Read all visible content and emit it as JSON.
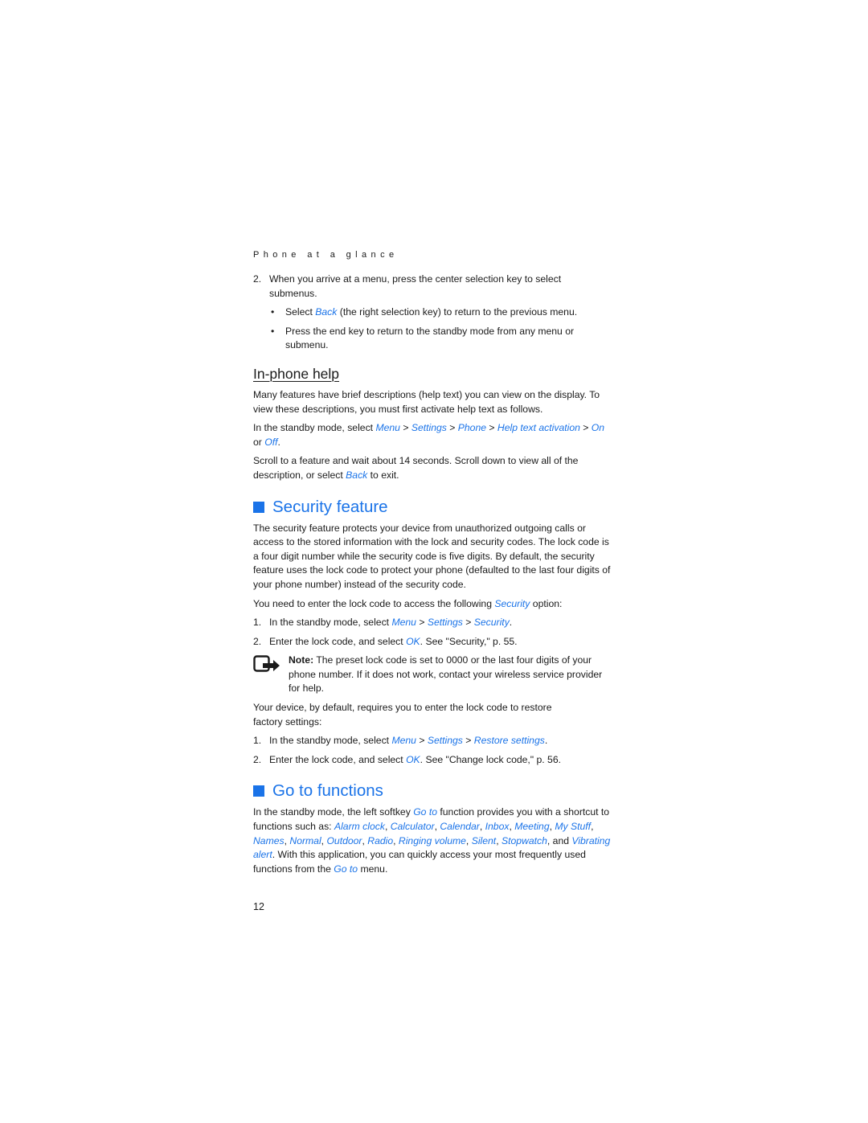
{
  "running_header": "Phone at a glance",
  "intro_list": {
    "item2": {
      "num": "2.",
      "text": "When you arrive at a menu, press the center selection key to select submenus."
    },
    "bullets": [
      {
        "dot": "•",
        "before": "Select ",
        "link": "Back",
        "after": " (the right selection key) to return to the previous menu."
      },
      {
        "dot": "•",
        "text": "Press the end key to return to the standby mode from any menu or submenu."
      }
    ]
  },
  "in_phone_help": {
    "heading": "In-phone help",
    "para1": "Many features have brief descriptions (help text) you can view on the display. To view these descriptions, you must first activate help text as follows.",
    "path": {
      "prefix": "In the standby mode, select ",
      "menu": "Menu",
      "sep": " > ",
      "settings": "Settings",
      "phone": "Phone",
      "help_text_activation": "Help text activation",
      "on": "On",
      "or": " or ",
      "off": "Off",
      "end": "."
    },
    "para3": {
      "before": "Scroll to a feature and wait about 14 seconds. Scroll down to view all of the description, or select ",
      "link": "Back",
      "after": " to exit."
    }
  },
  "security_feature": {
    "heading": "Security feature",
    "para1": "The security feature protects your device from unauthorized outgoing calls or access to the stored information with the lock and security codes. The lock code is a four digit number while the security code is five digits. By default, the security feature uses the lock code to protect your phone (defaulted to the last four digits of your phone number) instead of the security code.",
    "para2": {
      "before": "You need to enter the lock code to access the following ",
      "link": "Security",
      "after": " option:"
    },
    "steps1": [
      {
        "num": "1.",
        "prefix": "In the standby mode, select ",
        "menu": "Menu",
        "sep": " > ",
        "settings": "Settings",
        "target": "Security",
        "end": "."
      },
      {
        "num": "2.",
        "prefix": "Enter the lock code, and select ",
        "ok": "OK",
        "suffix": ". See \"Security,\" p. 55."
      }
    ],
    "note": {
      "icon": "note-hand-icon",
      "label": "Note:",
      "text": " The preset lock code is set to 0000 or the last four digits of your phone number. If it does not work, contact your wireless service provider for help."
    },
    "para3": "Your device, by default, requires you to enter the lock code to restore factory settings:",
    "steps2": [
      {
        "num": "1.",
        "prefix": "In the standby mode, select ",
        "menu": "Menu",
        "sep": " > ",
        "settings": "Settings",
        "target": "Restore settings",
        "end": "."
      },
      {
        "num": "2.",
        "prefix": "Enter the lock code, and select ",
        "ok": "OK",
        "suffix": ". See \"Change lock code,\" p. 56."
      }
    ]
  },
  "go_to_functions": {
    "heading": "Go to functions",
    "intro_before": "In the standby mode, the left softkey ",
    "goto": "Go to",
    "intro_after": " function provides you with a shortcut to functions such as: ",
    "functions": [
      "Alarm clock",
      "Calculator",
      "Calendar",
      "Inbox",
      "Meeting",
      "My Stuff",
      "Names",
      "Normal",
      "Outdoor",
      "Radio",
      "Ringing volume",
      "Silent",
      "Stopwatch"
    ],
    "and": ", and ",
    "last_function": "Vibrating alert",
    "outro_before": ". With this application, you can quickly access your most frequently used functions from the ",
    "goto2": "Go to",
    "outro_after": " menu."
  },
  "page_number": "12",
  "colors": {
    "accent_blue": "#1a73e8",
    "text": "#1a1a1a"
  }
}
